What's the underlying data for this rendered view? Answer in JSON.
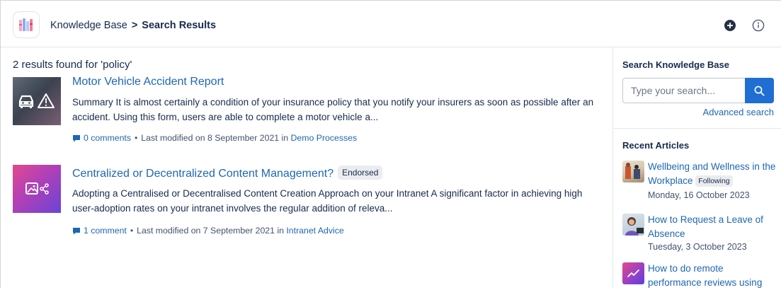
{
  "header": {
    "breadcrumb_root": "Knowledge Base",
    "breadcrumb_sep": ">",
    "breadcrumb_current": "Search Results",
    "add_icon": "plus-circle-icon",
    "info_icon": "info-icon"
  },
  "results": {
    "count_text": "2 results found for 'policy'",
    "items": [
      {
        "title": "Motor Vehicle Accident Report",
        "badge": "",
        "summary": "Summary It is almost certainly a condition of your insurance policy that you notify your insurers as soon as possible after an accident. Using this form, users are able to complete a motor vehicle a...",
        "comments": "0 comments",
        "modified": "Last modified on 8 September 2021 in",
        "category": "Demo Processes",
        "thumb_icons": [
          "car-icon",
          "warning-icon"
        ]
      },
      {
        "title": "Centralized or Decentralized Content Management?",
        "badge": "Endorsed",
        "summary": "Adopting a Centralised or Decentralised Content Creation Approach on your Intranet A significant factor in achieving high user-adoption rates on your intranet involves the regular addition of releva...",
        "comments": "1 comment",
        "modified": "Last modified on 7 September 2021 in",
        "category": "Intranet Advice",
        "thumb_icons": [
          "image-share-icon"
        ]
      }
    ],
    "separator": "•"
  },
  "sidebar": {
    "search_heading": "Search Knowledge Base",
    "search_placeholder": "Type your search...",
    "advanced_search": "Advanced search",
    "recent_heading": "Recent Articles",
    "articles": [
      {
        "title": "Wellbeing and Wellness in the Workplace",
        "badge": "Following",
        "date": "Monday, 16 October 2023"
      },
      {
        "title": "How to Request a Leave of Absence",
        "badge": "",
        "date": "Tuesday, 3 October 2023"
      },
      {
        "title": "How to do remote performance reviews using",
        "badge": "",
        "date": ""
      }
    ]
  },
  "colors": {
    "link": "#1d67b3",
    "primary_button": "#1f6ed4",
    "badge_bg": "#ebecef"
  }
}
